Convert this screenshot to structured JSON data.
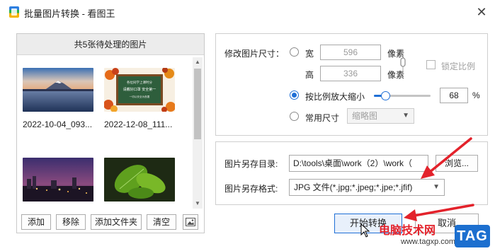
{
  "window": {
    "title": "批量图片转换 - 看图王",
    "close_symbol": "✕"
  },
  "left_panel": {
    "header": "共5张待处理的图片",
    "images": [
      {
        "name": "2022-10-04_093..."
      },
      {
        "name": "2022-12-08_111..."
      },
      {
        "name": ""
      },
      {
        "name": ""
      }
    ],
    "buttons": {
      "add": "添加",
      "remove": "移除",
      "add_folder": "添加文件夹",
      "clear": "清空"
    },
    "chalkboard_text": [
      "各位同学上课时分",
      "请戴好口罩 安全第一",
      "一切以安全为首要"
    ]
  },
  "resize": {
    "label": "修改图片尺寸：",
    "width_label": "宽",
    "width_value": "596",
    "height_label": "高",
    "height_value": "336",
    "unit": "像素",
    "lock_ratio": "锁定比例",
    "scale_label": "按比例放大缩小",
    "scale_value": "68",
    "scale_fraction": 0.2,
    "percent": "%",
    "common_label": "常用尺寸",
    "common_value": "缩略图"
  },
  "output": {
    "dir_label": "图片另存目录:",
    "dir_value": "D:\\tools\\桌面\\work（2）\\work（",
    "browse": "浏览...",
    "format_label": "图片另存格式:",
    "format_value": "JPG 文件(*.jpg;*.jpeg;*.jpe;*.jfif)"
  },
  "actions": {
    "start": "开始转换",
    "cancel": "取消"
  },
  "watermark": {
    "site": "电脑技术网",
    "url": "www.tagxp.com",
    "badge": "TAG"
  },
  "colors": {
    "accent": "#1f6fd6",
    "arrow": "#e3222b"
  }
}
